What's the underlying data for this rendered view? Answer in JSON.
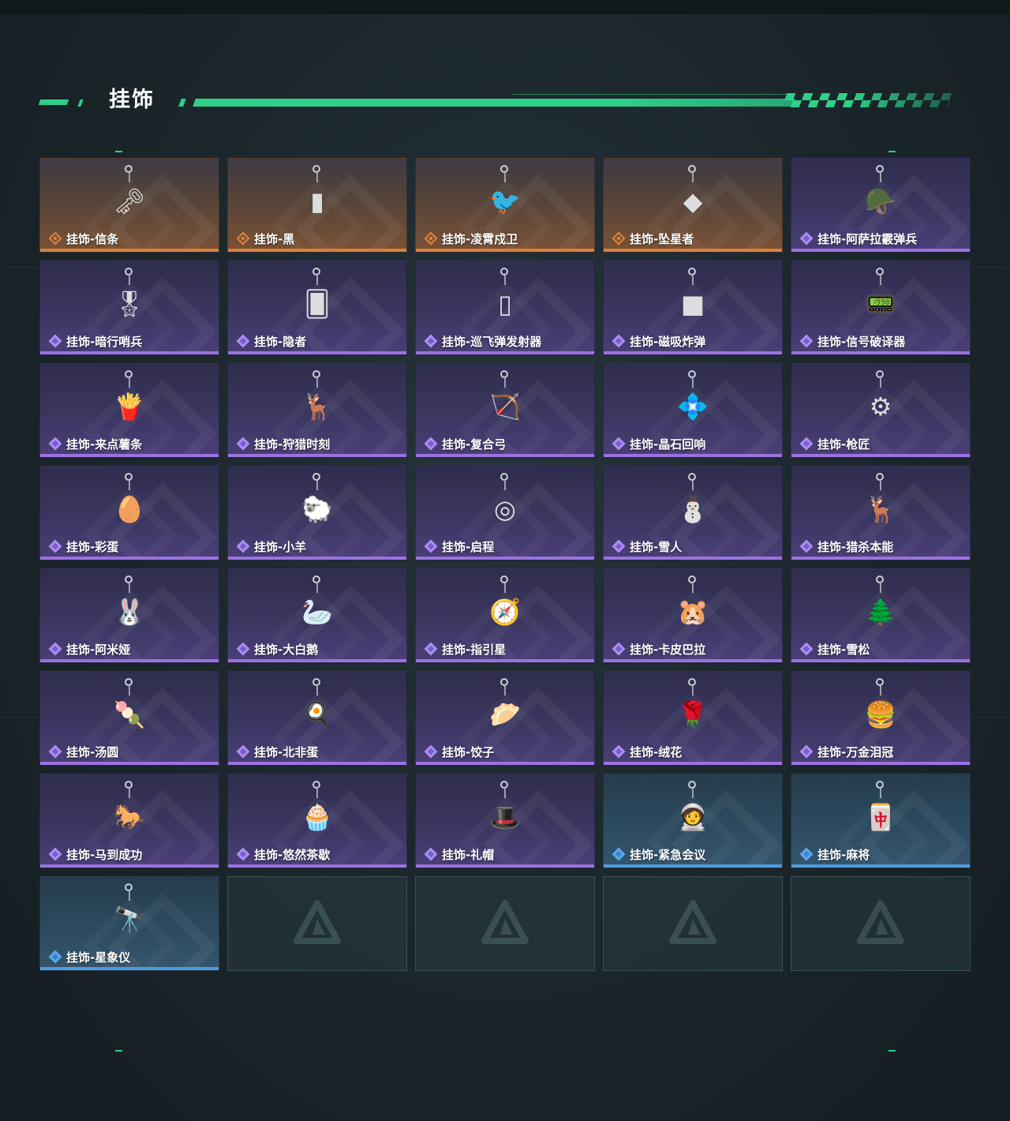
{
  "header": {
    "title": "挂饰"
  },
  "items": [
    {
      "name": "挂饰-信条",
      "rarity": "orange",
      "icon": "🗝"
    },
    {
      "name": "挂饰-黑",
      "rarity": "orange",
      "icon": "▮"
    },
    {
      "name": "挂饰-凌霄戍卫",
      "rarity": "orange",
      "icon": "🐦"
    },
    {
      "name": "挂饰-坠星者",
      "rarity": "orange",
      "icon": "◆"
    },
    {
      "name": "挂饰-阿萨拉霰弹兵",
      "rarity": "purple",
      "icon": "🪖"
    },
    {
      "name": "挂饰-暗行哨兵",
      "rarity": "purple",
      "icon": "🎖"
    },
    {
      "name": "挂饰-隐者",
      "rarity": "purple",
      "icon": "🂠"
    },
    {
      "name": "挂饰-巡飞弹发射器",
      "rarity": "purple",
      "icon": "▯"
    },
    {
      "name": "挂饰-磁吸炸弹",
      "rarity": "purple",
      "icon": "■"
    },
    {
      "name": "挂饰-信号破译器",
      "rarity": "purple",
      "icon": "📟"
    },
    {
      "name": "挂饰-来点薯条",
      "rarity": "purple",
      "icon": "🍟"
    },
    {
      "name": "挂饰-狩猎时刻",
      "rarity": "purple",
      "icon": "🦌"
    },
    {
      "name": "挂饰-复合弓",
      "rarity": "purple",
      "icon": "🏹"
    },
    {
      "name": "挂饰-晶石回响",
      "rarity": "purple",
      "icon": "💠"
    },
    {
      "name": "挂饰-枪匠",
      "rarity": "purple",
      "icon": "⚙"
    },
    {
      "name": "挂饰-彩蛋",
      "rarity": "purple",
      "icon": "🥚"
    },
    {
      "name": "挂饰-小羊",
      "rarity": "purple",
      "icon": "🐑"
    },
    {
      "name": "挂饰-启程",
      "rarity": "purple",
      "icon": "◎"
    },
    {
      "name": "挂饰-雪人",
      "rarity": "purple",
      "icon": "⛄"
    },
    {
      "name": "挂饰-猎杀本能",
      "rarity": "purple",
      "icon": "🦌"
    },
    {
      "name": "挂饰-阿米娅",
      "rarity": "purple",
      "icon": "🐰"
    },
    {
      "name": "挂饰-大白鹅",
      "rarity": "purple",
      "icon": "🦢"
    },
    {
      "name": "挂饰-指引星",
      "rarity": "purple",
      "icon": "🧭"
    },
    {
      "name": "挂饰-卡皮巴拉",
      "rarity": "purple",
      "icon": "🐹"
    },
    {
      "name": "挂饰-雪松",
      "rarity": "purple",
      "icon": "🌲"
    },
    {
      "name": "挂饰-汤圆",
      "rarity": "purple",
      "icon": "🍡"
    },
    {
      "name": "挂饰-北非蛋",
      "rarity": "purple",
      "icon": "🍳"
    },
    {
      "name": "挂饰-饺子",
      "rarity": "purple",
      "icon": "🥟"
    },
    {
      "name": "挂饰-绒花",
      "rarity": "purple",
      "icon": "🌹"
    },
    {
      "name": "挂饰-万金泪冠",
      "rarity": "purple",
      "icon": "🍔"
    },
    {
      "name": "挂饰-马到成功",
      "rarity": "purple",
      "icon": "🐎"
    },
    {
      "name": "挂饰-悠然茶歇",
      "rarity": "purple",
      "icon": "🧁"
    },
    {
      "name": "挂饰-礼帽",
      "rarity": "purple",
      "icon": "🎩"
    },
    {
      "name": "挂饰-紧急会议",
      "rarity": "blue",
      "icon": "🧑‍🚀"
    },
    {
      "name": "挂饰-麻将",
      "rarity": "blue",
      "icon": "🀄"
    },
    {
      "name": "挂饰-星象仪",
      "rarity": "blue",
      "icon": "🔭"
    }
  ],
  "empty_slots": 4
}
